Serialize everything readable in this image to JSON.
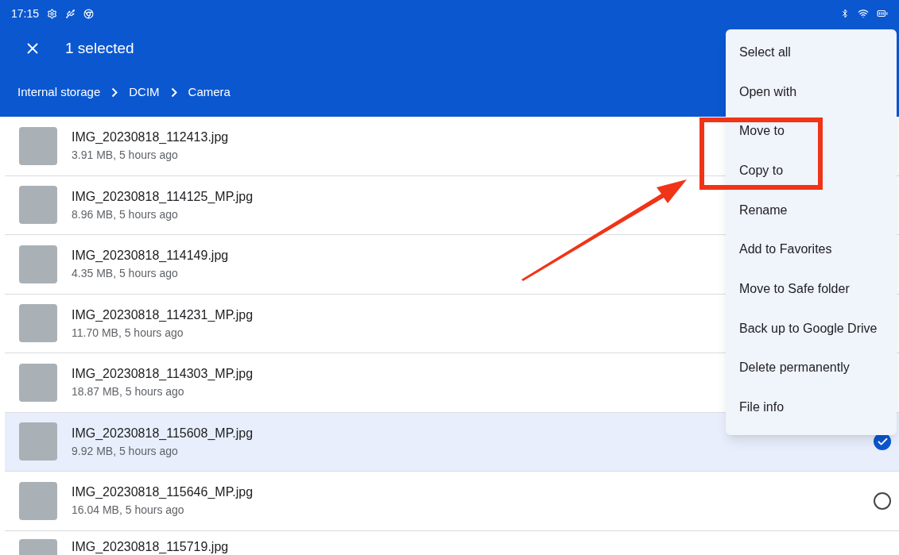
{
  "status_bar": {
    "time": "17:15"
  },
  "app_bar": {
    "title": "1 selected"
  },
  "breadcrumbs": [
    "Internal storage",
    "DCIM",
    "Camera"
  ],
  "files": [
    {
      "name": "IMG_20230818_112413.jpg",
      "details": "3.91 MB, 5 hours ago",
      "selected": false
    },
    {
      "name": "IMG_20230818_114125_MP.jpg",
      "details": "8.96 MB, 5 hours ago",
      "selected": false
    },
    {
      "name": "IMG_20230818_114149.jpg",
      "details": "4.35 MB, 5 hours ago",
      "selected": false
    },
    {
      "name": "IMG_20230818_114231_MP.jpg",
      "details": "11.70 MB, 5 hours ago",
      "selected": false
    },
    {
      "name": "IMG_20230818_114303_MP.jpg",
      "details": "18.87 MB, 5 hours ago",
      "selected": false
    },
    {
      "name": "IMG_20230818_115608_MP.jpg",
      "details": "9.92 MB, 5 hours ago",
      "selected": true
    },
    {
      "name": "IMG_20230818_115646_MP.jpg",
      "details": "16.04 MB, 5 hours ago",
      "selected": false
    }
  ],
  "partial_row": {
    "name": "IMG_20230818_115719.jpg"
  },
  "menu": [
    "Select all",
    "Open with",
    "Move to",
    "Copy to",
    "Rename",
    "Add to Favorites",
    "Move to Safe folder",
    "Back up to Google Drive",
    "Delete permanently",
    "File info"
  ]
}
